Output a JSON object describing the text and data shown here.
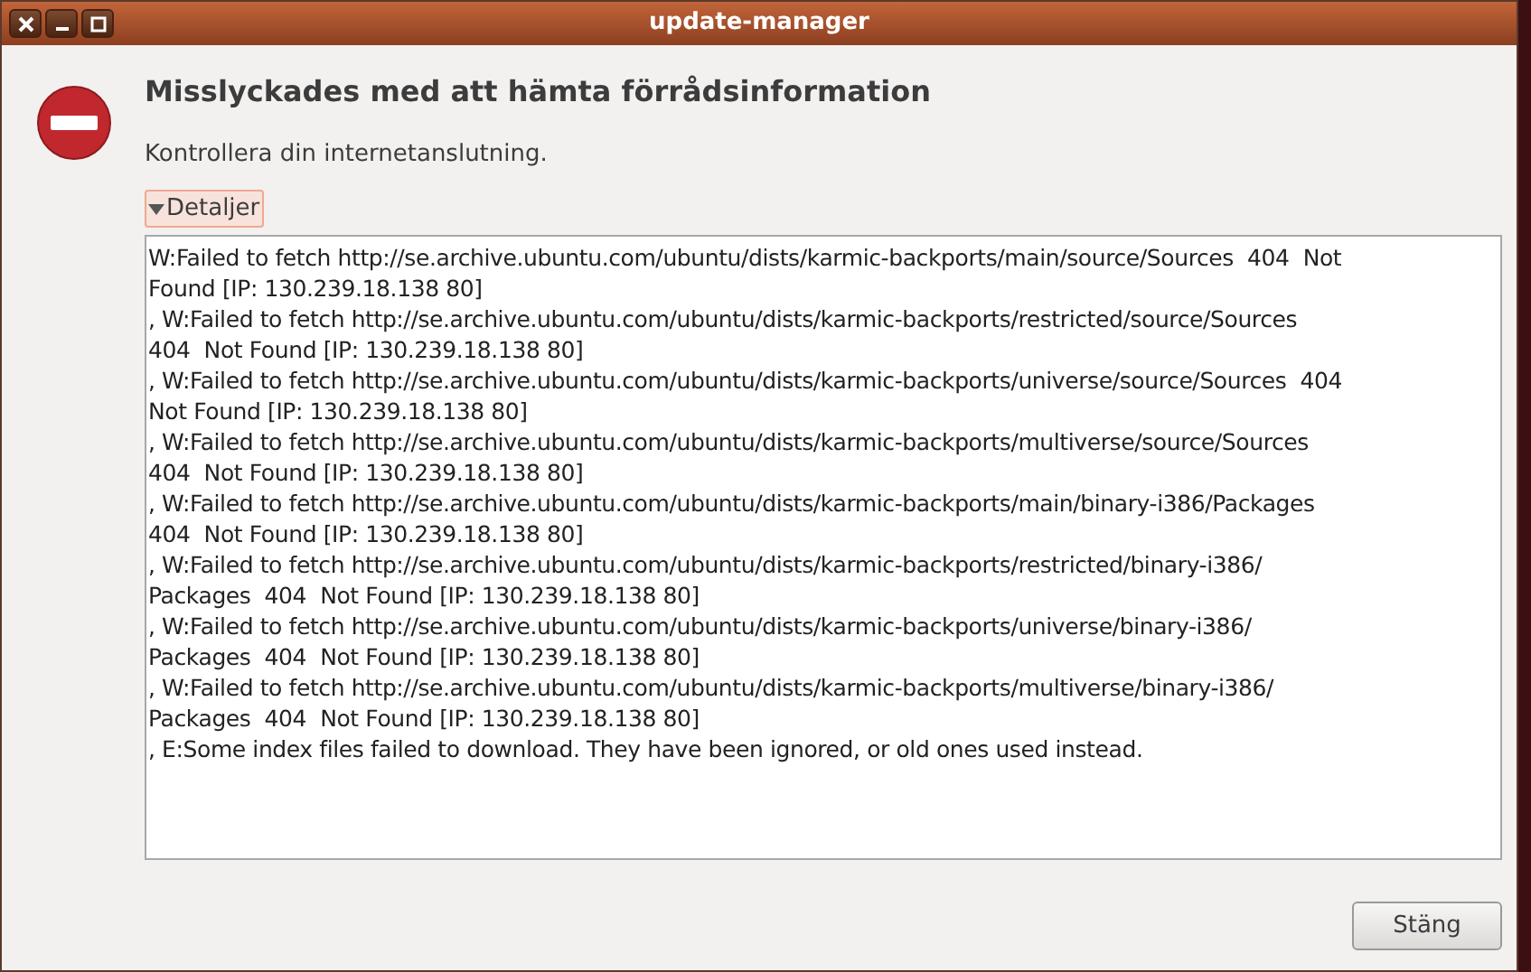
{
  "window": {
    "title": "update-manager"
  },
  "dialog": {
    "heading": "Misslyckades med att hämta förrådsinformation",
    "message": "Kontrollera din internetanslutning.",
    "details": {
      "label": "Detaljer",
      "expanded": true,
      "lines": [
        "W:Failed to fetch http://se.archive.ubuntu.com/ubuntu/dists/karmic-backports/main/source/Sources  404  Not",
        "Found [IP: 130.239.18.138 80]",
        ", W:Failed to fetch http://se.archive.ubuntu.com/ubuntu/dists/karmic-backports/restricted/source/Sources",
        "404  Not Found [IP: 130.239.18.138 80]",
        ", W:Failed to fetch http://se.archive.ubuntu.com/ubuntu/dists/karmic-backports/universe/source/Sources  404",
        "Not Found [IP: 130.239.18.138 80]",
        ", W:Failed to fetch http://se.archive.ubuntu.com/ubuntu/dists/karmic-backports/multiverse/source/Sources",
        "404  Not Found [IP: 130.239.18.138 80]",
        ", W:Failed to fetch http://se.archive.ubuntu.com/ubuntu/dists/karmic-backports/main/binary-i386/Packages",
        "404  Not Found [IP: 130.239.18.138 80]",
        ", W:Failed to fetch http://se.archive.ubuntu.com/ubuntu/dists/karmic-backports/restricted/binary-i386/",
        "Packages  404  Not Found [IP: 130.239.18.138 80]",
        ", W:Failed to fetch http://se.archive.ubuntu.com/ubuntu/dists/karmic-backports/universe/binary-i386/",
        "Packages  404  Not Found [IP: 130.239.18.138 80]",
        ", W:Failed to fetch http://se.archive.ubuntu.com/ubuntu/dists/karmic-backports/multiverse/binary-i386/",
        "Packages  404  Not Found [IP: 130.239.18.138 80]",
        ", E:Some index files failed to download. They have been ignored, or old ones used instead."
      ]
    }
  },
  "buttons": [
    {
      "label": "Stäng"
    }
  ]
}
